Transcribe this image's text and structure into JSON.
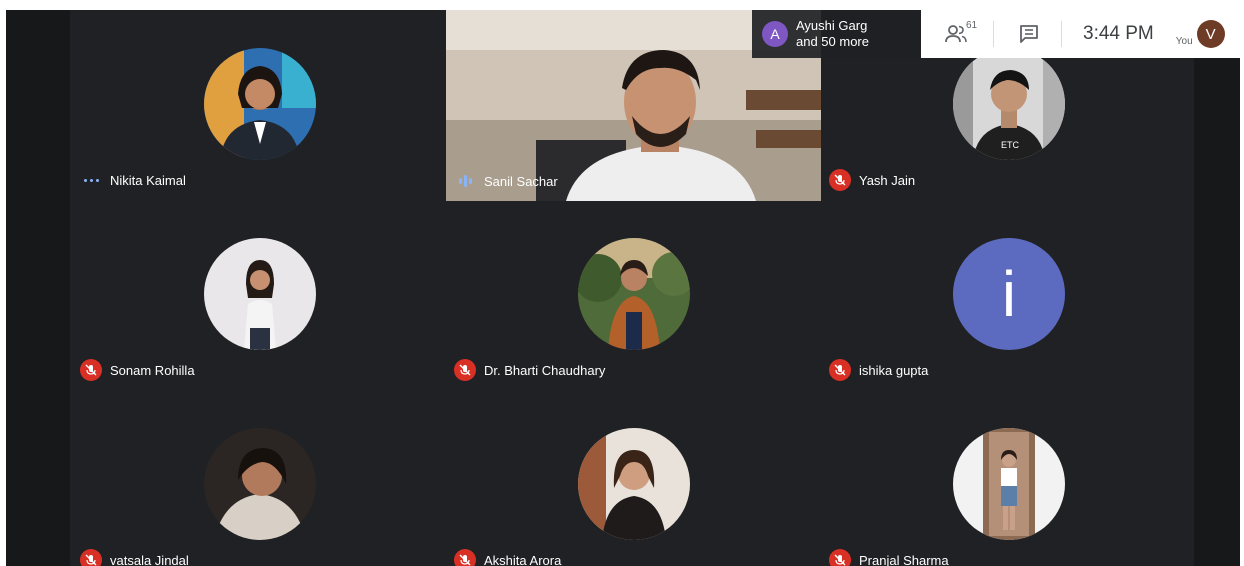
{
  "presenter": {
    "initial": "A",
    "line1": "Ayushi Garg",
    "line2": "and 50 more"
  },
  "toolbar": {
    "participant_count": "61",
    "time": "3:44 PM",
    "you_label": "You",
    "self_initial": "V"
  },
  "colors": {
    "background": "#202124",
    "mic_off": "#d93025",
    "speaking": "#8ab4f8",
    "toolbar_bg": "#ffffff"
  },
  "participants": [
    {
      "name": "Nikita Kaimal",
      "status": "dots-icon"
    },
    {
      "name": "Sanil Sachar",
      "status": "speaking-icon"
    },
    {
      "name": "Yash Jain",
      "status": "mic-off-icon"
    },
    {
      "name": "Sonam Rohilla",
      "status": "mic-off-icon"
    },
    {
      "name": "Dr. Bharti Chaudhary",
      "status": "mic-off-icon"
    },
    {
      "name": "ishika gupta",
      "status": "mic-off-icon",
      "initial": "i"
    },
    {
      "name": "vatsala Jindal",
      "status": "mic-off-icon"
    },
    {
      "name": "Akshita Arora",
      "status": "mic-off-icon"
    },
    {
      "name": "Pranjal Sharma",
      "status": "mic-off-icon"
    }
  ]
}
